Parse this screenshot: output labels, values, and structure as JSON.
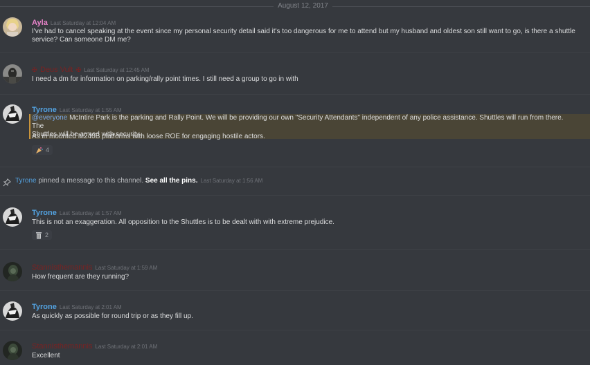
{
  "divider": {
    "date": "August 12, 2017"
  },
  "messages": [
    {
      "username": "Ayla",
      "timestamp": "Last Saturday at 12:04 AM",
      "text_line1": "I've had to cancel speaking at the event since my personal security detail said it's too dangerous for me to attend but my husband and oldest son still want to go, is there a shuttle",
      "text_line2": "service? Can someone DM me?",
      "color": "#e984ca"
    },
    {
      "username": "Deus Vult",
      "prefix_symbol": "✠",
      "suffix_symbol": "✠",
      "timestamp": "Last Saturday at 12:45 AM",
      "text": "I need a dm for information on parking/rally point times. I still need a group to go in with",
      "color": "#7a2222"
    },
    {
      "username": "Tyrone",
      "timestamp": "Last Saturday at 1:55 AM",
      "mention": "@everyone",
      "text_line1": " McIntire Park is the parking and Rally Point. We will be providing our own \"Security Attendants\" independent of any police assistance. Shuttles will run from there. The",
      "text_line2": "Shuttles will be armed with security.",
      "text2": "As in mounted M240B platforms with loose ROE for engaging hostile actors.",
      "reaction": {
        "icon": "cheer-icon",
        "count": "4"
      },
      "color": "#53a2e0"
    },
    {
      "username": "Tyrone",
      "timestamp": "Last Saturday at 1:57 AM",
      "text": "This is not an exaggeration. All opposition to the Shuttles is to be dealt with with extreme prejudice.",
      "reaction": {
        "icon": "trash-icon",
        "count": "2"
      }
    },
    {
      "username": "Stannisthemannis",
      "timestamp": "Last Saturday at 1:59 AM",
      "text": "How frequent are they running?"
    },
    {
      "username": "Tyrone",
      "timestamp": "Last Saturday at 2:01 AM",
      "text": "As quickly as possible for round trip or as they fill up."
    },
    {
      "username": "Stannisthemannis",
      "timestamp": "Last Saturday at 2:01 AM",
      "text": "Excellent"
    }
  ],
  "pin": {
    "user": "Tyrone",
    "text": " pinned a message to this channel. ",
    "link": "See all the pins.",
    "timestamp": "Last Saturday at 1:56 AM",
    "icon": "pin-icon"
  }
}
